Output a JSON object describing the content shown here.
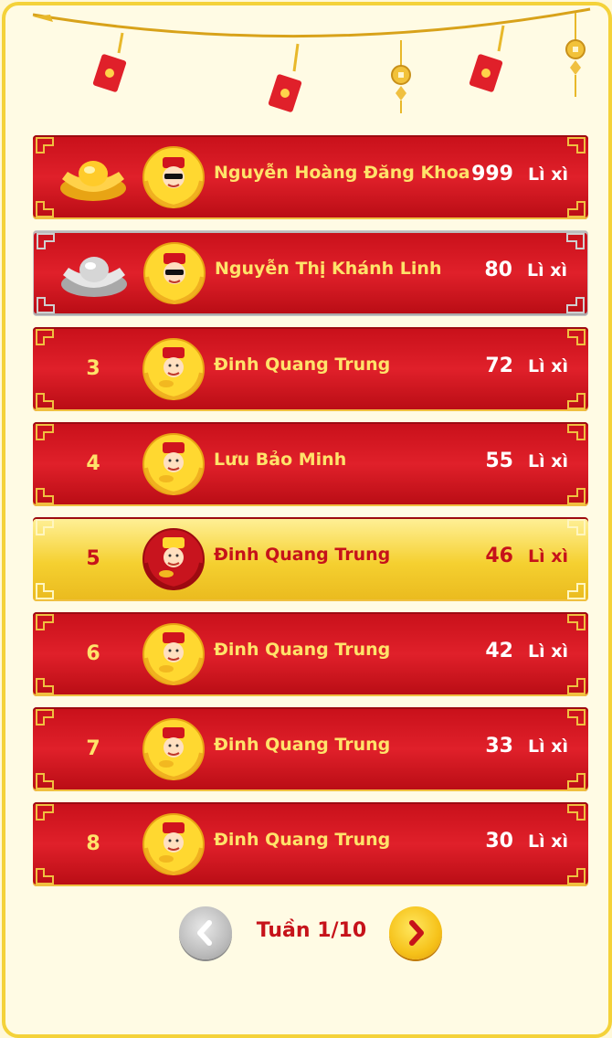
{
  "leaderboard": {
    "unit_label": "Lì xì",
    "rows": [
      {
        "rank": "",
        "medal": "gold-ingot-icon",
        "name": "Nguyễn Hoàng Đăng Khoa",
        "score": "999",
        "avatar": "god-of-wealth-sunglasses-avatar"
      },
      {
        "rank": "",
        "medal": "silver-ingot-icon",
        "name": "Nguyễn Thị Khánh Linh",
        "score": "80",
        "avatar": "god-of-wealth-sunglasses-avatar"
      },
      {
        "rank": "3",
        "name": "Đinh Quang Trung",
        "score": "72",
        "avatar": "god-of-wealth-avatar"
      },
      {
        "rank": "4",
        "name": "Lưu Bảo Minh",
        "score": "55",
        "avatar": "god-of-wealth-avatar"
      },
      {
        "rank": "5",
        "name": "Đinh Quang Trung",
        "score": "46",
        "avatar": "god-of-wealth-avatar",
        "highlighted": true
      },
      {
        "rank": "6",
        "name": "Đinh Quang Trung",
        "score": "42",
        "avatar": "god-of-wealth-avatar"
      },
      {
        "rank": "7",
        "name": "Đinh Quang Trung",
        "score": "33",
        "avatar": "god-of-wealth-avatar"
      },
      {
        "rank": "8",
        "name": "Đinh Quang Trung",
        "score": "30",
        "avatar": "god-of-wealth-avatar"
      }
    ]
  },
  "pager": {
    "label": "Tuần 1/10",
    "prev_icon": "chevron-left-icon",
    "next_icon": "chevron-right-icon"
  },
  "colors": {
    "row_red": "#d0141e",
    "row_highlight": "#f5d030",
    "name_yellow": "#ffe36a",
    "accent_red": "#c6121a",
    "frame_gold": "#f4d23a"
  }
}
